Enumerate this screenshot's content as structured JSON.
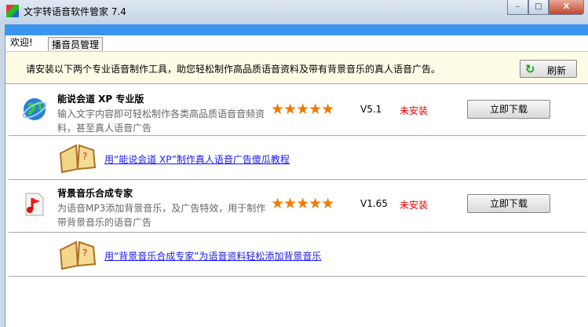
{
  "window": {
    "title": "文字转语音软件管家 7.4",
    "minimize": "–",
    "maximize": "□",
    "close": "X"
  },
  "tabs": [
    {
      "label": "欢迎!"
    },
    {
      "label": "播音员管理"
    }
  ],
  "notice": {
    "text": "请安装以下两个专业语音制作工具，助您轻松制作高品质语音资料及带有背景音乐的真人语音广告。",
    "refresh_label": "刷新"
  },
  "products": [
    {
      "name": "能说会道 XP 专业版",
      "description": "输入文字内容即可轻松制作各类高品质语音音频资料，甚至真人语音广告",
      "rating": 5,
      "stars": "★★★★★",
      "version": "V5.1",
      "status": "未安装",
      "download_label": "立即下载",
      "tutorial_link": "用“能说会道 XP”制作真人语音广告傻瓜教程"
    },
    {
      "name": "背景音乐合成专家",
      "description": "为语音MP3添加背景音乐，及广告特效，用于制作带背景音乐的语音广告",
      "rating": 5,
      "stars": "★★★★★",
      "version": "V1.65",
      "status": "未安装",
      "download_label": "立即下载",
      "tutorial_link": "用“背景音乐合成专家”为语音资料轻松添加背景音乐"
    }
  ]
}
